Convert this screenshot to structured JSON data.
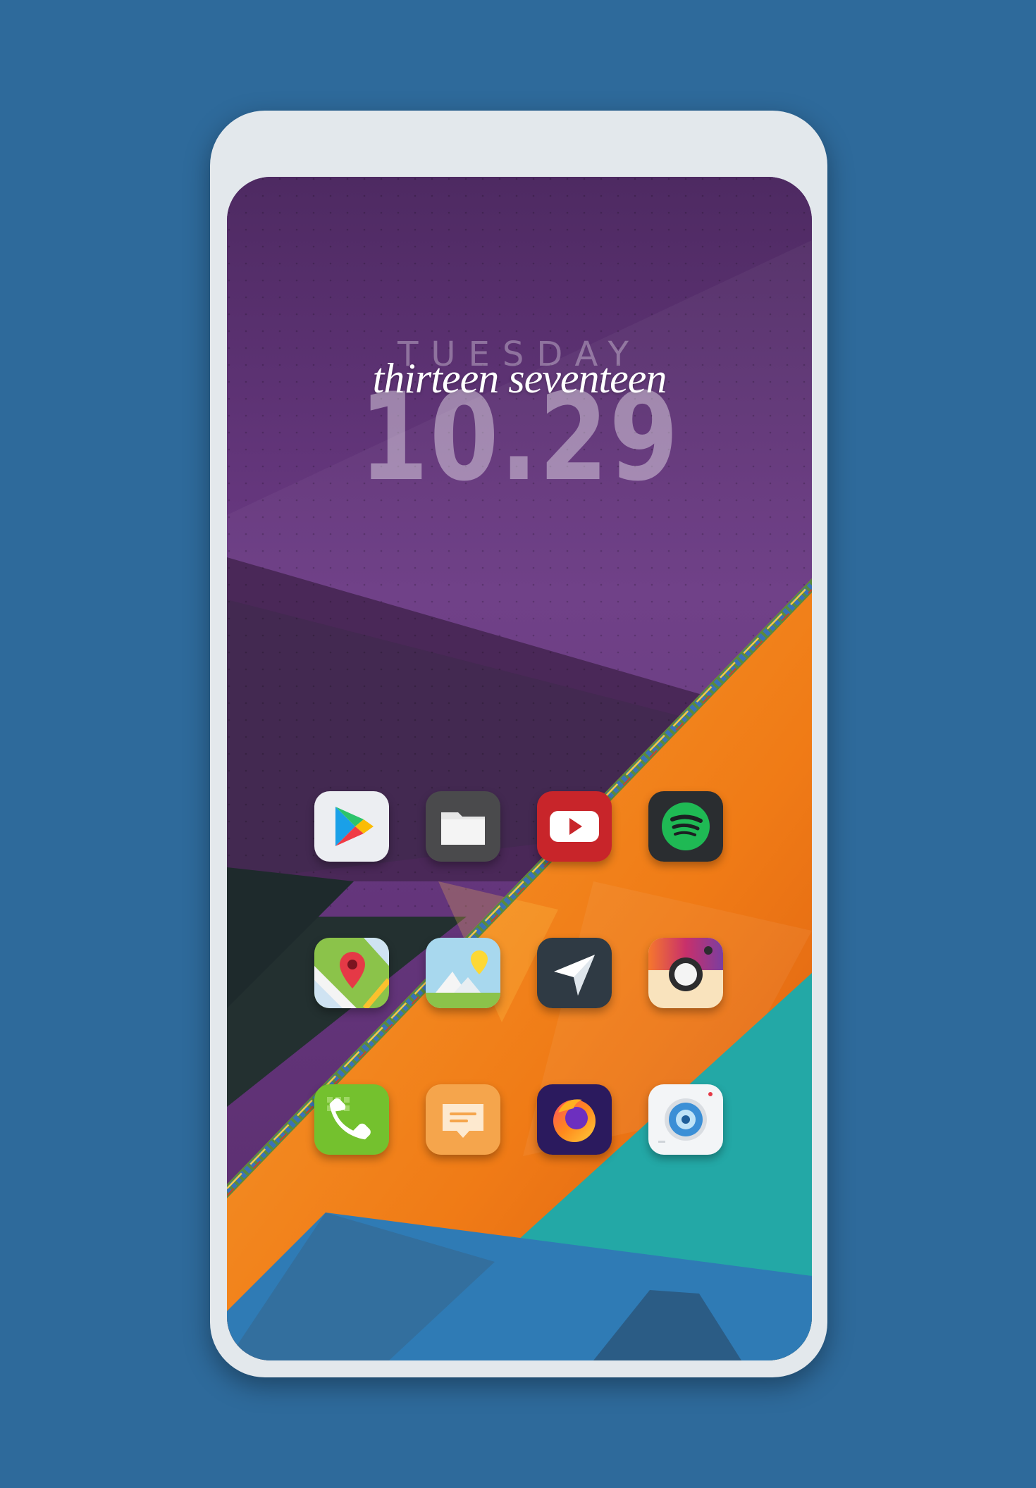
{
  "clock": {
    "day": "TUESDAY",
    "words": "thirteen seventeen",
    "time": "10.29"
  },
  "apps": [
    {
      "name": "play-store-icon"
    },
    {
      "name": "files-icon"
    },
    {
      "name": "youtube-icon"
    },
    {
      "name": "spotify-icon"
    },
    {
      "name": "maps-icon"
    },
    {
      "name": "gallery-icon"
    },
    {
      "name": "telegram-icon"
    },
    {
      "name": "instagram-icon"
    },
    {
      "name": "phone-icon"
    },
    {
      "name": "messages-icon"
    },
    {
      "name": "firefox-icon"
    },
    {
      "name": "camera-icon"
    }
  ],
  "colors": {
    "background": "#2e6a9b",
    "frame": "#e3e8ec",
    "purple": "#5a2e6e",
    "orange": "#f07b16",
    "teal": "#23a8a6",
    "blue": "#2f7bb5"
  }
}
